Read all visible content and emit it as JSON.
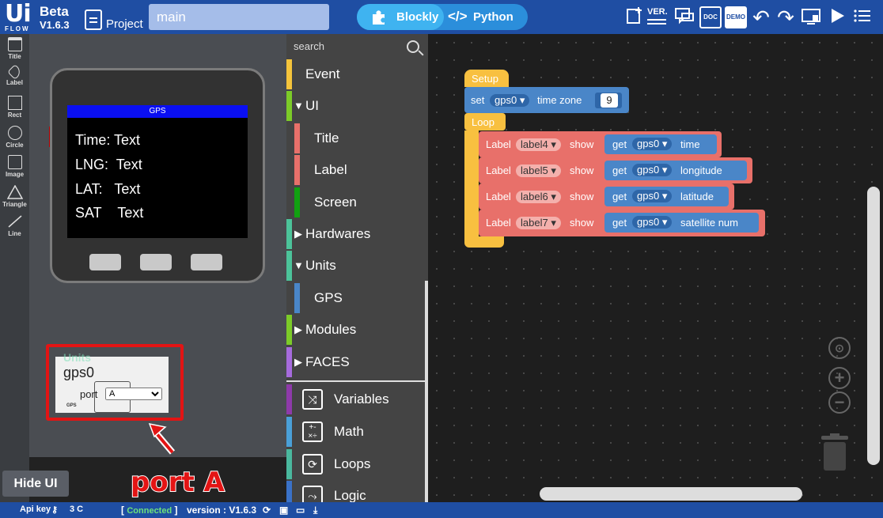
{
  "header": {
    "logo_top": "Ui",
    "logo_bottom": "FLOW",
    "beta": "Beta",
    "version": "V1.6.3",
    "project_label": "Project",
    "project_name": "main",
    "tab_blockly": "Blockly",
    "tab_python": "Python",
    "icons": [
      "new-file-icon",
      "version-icon",
      "chat-icon",
      "doc-icon",
      "demo-icon",
      "undo-icon",
      "redo-icon",
      "download-to-device-icon",
      "run-icon",
      "menu-icon"
    ],
    "version_btn": "VER.",
    "doc_btn": "DOC",
    "demo_btn": "DEMO"
  },
  "tools": [
    {
      "label": "Title",
      "icon": "title-icon"
    },
    {
      "label": "Label",
      "icon": "label-icon"
    },
    {
      "label": "Rect",
      "icon": "rect-icon"
    },
    {
      "label": "Circle",
      "icon": "circle-icon"
    },
    {
      "label": "Image",
      "icon": "image-icon"
    },
    {
      "label": "Triangle",
      "icon": "triangle-icon"
    },
    {
      "label": "Line",
      "icon": "line-icon"
    }
  ],
  "device": {
    "screen_title": "GPS",
    "rows": [
      {
        "label": "Time:",
        "value": "Text"
      },
      {
        "label": "LNG:",
        "value": "Text"
      },
      {
        "label": "LAT:",
        "value": "Text"
      },
      {
        "label": "SAT",
        "value": "Text"
      }
    ]
  },
  "unit": {
    "overlay_text": "Units",
    "name": "gps0",
    "port_label": "port",
    "port_value": "A",
    "thumb_label": "GPS"
  },
  "callout": "port A",
  "hide_ui": "Hide UI",
  "search_placeholder": "search",
  "categories": [
    {
      "label": "Event",
      "color": "#f5c43b",
      "arrow": ""
    },
    {
      "label": "UI",
      "color": "#7ccb28",
      "arrow": "▼"
    },
    {
      "label": "Title",
      "color": "#e8706a",
      "arrow": ""
    },
    {
      "label": "Label",
      "color": "#e8706a",
      "arrow": ""
    },
    {
      "label": "Screen",
      "color": "#11a111",
      "arrow": ""
    },
    {
      "label": "Hardwares",
      "color": "#4cc39a",
      "arrow": "▶"
    },
    {
      "label": "Units",
      "color": "#4cc39a",
      "arrow": "▼"
    },
    {
      "label": "GPS",
      "color": "#4a86c8",
      "arrow": ""
    },
    {
      "label": "Modules",
      "color": "#7ccb28",
      "arrow": "▶"
    },
    {
      "label": "FACES",
      "color": "#a66bdd",
      "arrow": "▶"
    },
    {
      "label": "Variables",
      "color": "#8e3aaa",
      "arrow": ""
    },
    {
      "label": "Math",
      "color": "#4aa0d8",
      "arrow": ""
    },
    {
      "label": "Loops",
      "color": "#4ab89e",
      "arrow": ""
    },
    {
      "label": "Logic",
      "color": "#3a72c8",
      "arrow": ""
    }
  ],
  "blocks": {
    "setup": "Setup",
    "set": "set",
    "gps_var": "gps0",
    "time_zone": "time zone",
    "tz_value": "9",
    "loop": "Loop",
    "label_word": "Label",
    "show": "show",
    "get": "get",
    "lines": [
      {
        "label": "label4",
        "prop": "time"
      },
      {
        "label": "label5",
        "prop": "longitude"
      },
      {
        "label": "label6",
        "prop": "latitude"
      },
      {
        "label": "label7",
        "prop": "satellite num"
      }
    ]
  },
  "footer": {
    "api_key_label": "Api key :",
    "api_key_value": "3        C",
    "status": "Connected",
    "version_label": "version : V1.6.3"
  },
  "colors": {
    "header_blue": "#1f4ea3",
    "setup_yellow": "#f8c040",
    "gps_blue": "#4a86c8",
    "label_red": "#e8706a",
    "highlight_red": "#e31414",
    "connected_green": "#6ee27a"
  }
}
